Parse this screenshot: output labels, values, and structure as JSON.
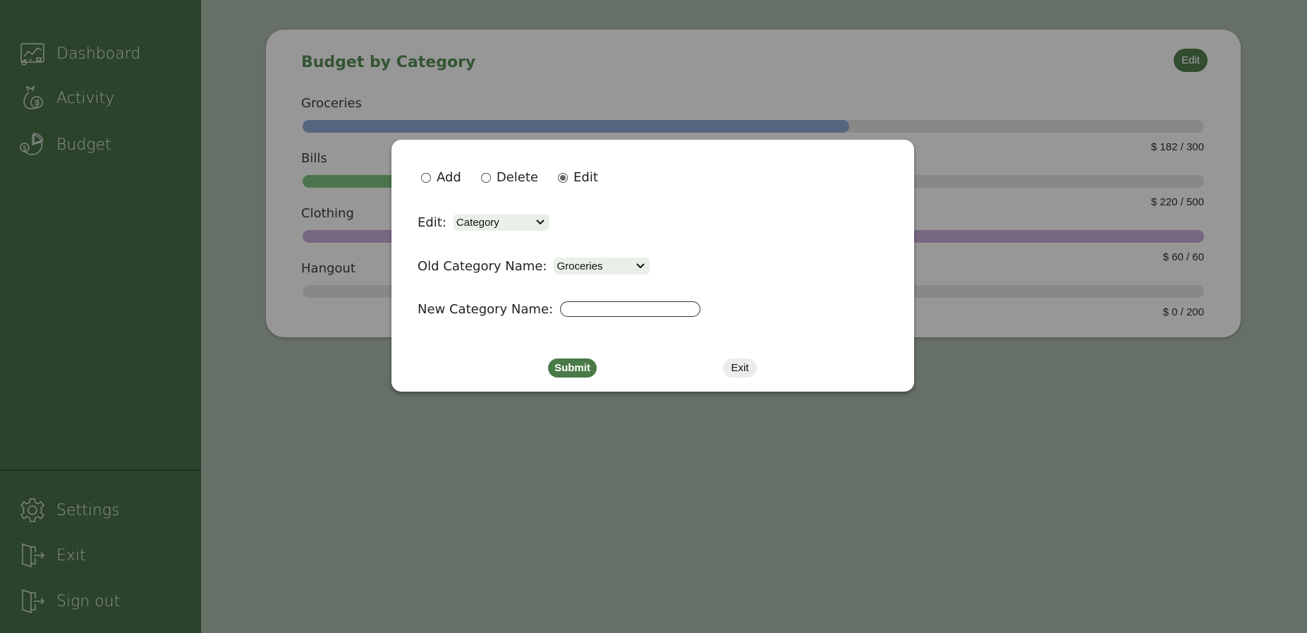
{
  "sidebar": {
    "items": [
      {
        "label": "Dashboard",
        "icon": "dashboard-chart-icon"
      },
      {
        "label": "Activity",
        "icon": "money-bag-icon"
      },
      {
        "label": "Budget",
        "icon": "pie-chart-coins-icon"
      }
    ],
    "bottom_items": [
      {
        "label": "Settings",
        "icon": "gear-icon"
      },
      {
        "label": "Exit",
        "icon": "door-exit-icon"
      },
      {
        "label": "Sign out",
        "icon": "sign-out-icon"
      }
    ]
  },
  "card": {
    "title": "Budget by Category",
    "edit_label": "Edit",
    "categories": [
      {
        "name": "Groceries",
        "amount": "$ 182 / 300",
        "spent": 182,
        "limit": 300,
        "color": "#7b97c5"
      },
      {
        "name": "Bills",
        "amount": "$ 220 / 500",
        "spent": 220,
        "limit": 500,
        "color": "#6ab26a"
      },
      {
        "name": "Clothing",
        "amount": "$ 60 / 60",
        "spent": 60,
        "limit": 60,
        "color": "#b89ccb"
      },
      {
        "name": "Hangout",
        "amount": "$ 0 / 200",
        "spent": 0,
        "limit": 200,
        "color": "#7b97c5"
      }
    ]
  },
  "modal": {
    "mode_options": [
      {
        "label": "Add",
        "checked": false
      },
      {
        "label": "Delete",
        "checked": false
      },
      {
        "label": "Edit",
        "checked": true
      }
    ],
    "edit_label": "Edit:",
    "edit_value": "Category",
    "old_name_label": "Old Category Name:",
    "old_name_value": "Groceries",
    "new_name_label": "New Category Name:",
    "new_name_value": "",
    "submit_label": "Submit",
    "exit_label": "Exit"
  }
}
